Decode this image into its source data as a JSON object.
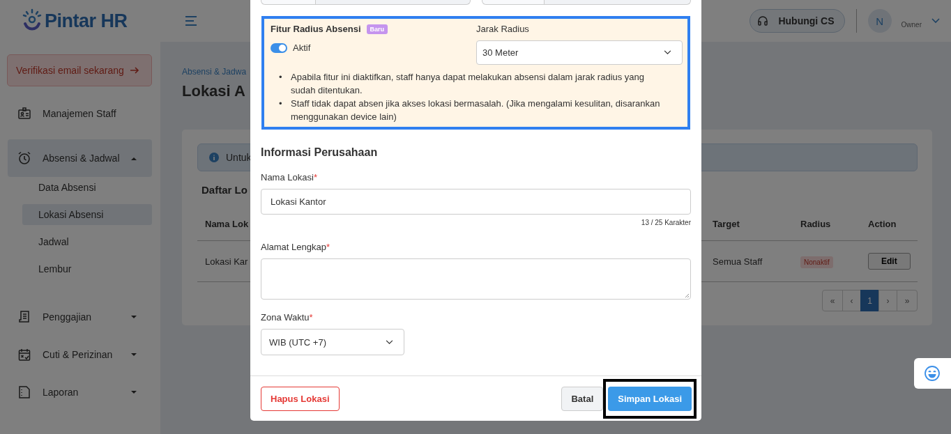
{
  "sidebar": {
    "logo": "Pintar HR",
    "verify_button": "Verifikasi email sekarang",
    "items": [
      {
        "label": "Manajemen Staff",
        "kind": "link"
      },
      {
        "label": "Absensi & Jadwal",
        "kind": "group",
        "expanded": true,
        "children": [
          {
            "label": "Data Absensi",
            "selected": false
          },
          {
            "label": "Lokasi Absensi",
            "selected": true
          },
          {
            "label": "Jadwal",
            "selected": false
          },
          {
            "label": "Lembur",
            "selected": false
          }
        ]
      },
      {
        "label": "Penggajian",
        "kind": "group",
        "expanded": false
      },
      {
        "label": "Cuti & Perizinan",
        "kind": "group",
        "expanded": false
      },
      {
        "label": "Laporan",
        "kind": "group",
        "expanded": false
      }
    ]
  },
  "header": {
    "contact_button": "Hubungi CS",
    "avatar": "N",
    "role": "Owner"
  },
  "main": {
    "breadcrumb": "Absensi & Jadwa",
    "title": "Lokasi A",
    "info": "Untuk",
    "list_title": "Daftar Lo",
    "table": {
      "columns": [
        "Nama Lok",
        "Target",
        "Radius",
        "Action"
      ],
      "rows": [
        {
          "name": "Lokasi Kar",
          "target": "Semua Staff",
          "radius": "Nonaktif",
          "action": "Edit"
        }
      ]
    },
    "pagination": [
      {
        "label": "«",
        "selected": false
      },
      {
        "label": "‹",
        "selected": false
      },
      {
        "label": "1",
        "selected": true
      },
      {
        "label": "›",
        "selected": false
      },
      {
        "label": "»",
        "selected": false
      }
    ]
  },
  "modal": {
    "radius_feature": {
      "title": "Fitur Radius Absensi",
      "badge": "Baru",
      "on": true,
      "toggle_label": "Aktif",
      "distance_label": "Jarak Radius",
      "distance_value": "30 Meter",
      "notes": [
        {
          "bullet": "•",
          "text": "Apabila fitur ini diaktifkan, staff hanya dapat melakukan absensi dalam jarak radius yang sudah ditentukan."
        },
        {
          "bullet": "•",
          "text": "Staff tidak dapat absen jika akses lokasi bermasalah. (Jika mengalami kesulitan, disarankan menggunakan device lain)"
        }
      ]
    },
    "section_title": "Informasi Perusahaan",
    "fields": [
      {
        "kind": "input",
        "label": "Nama Lokasi",
        "required_mark": "*",
        "value": "Lokasi Kantor",
        "counter": "13 / 25 Karakter"
      },
      {
        "kind": "textarea",
        "label": "Alamat Lengkap",
        "required_mark": "*"
      },
      {
        "kind": "select",
        "label": "Zona Waktu",
        "required_mark": "*",
        "value": "WIB (UTC +7)"
      }
    ],
    "delete_button": "Hapus Lokasi",
    "cancel_button": "Batal",
    "save_button": "Simpan Lokasi"
  }
}
